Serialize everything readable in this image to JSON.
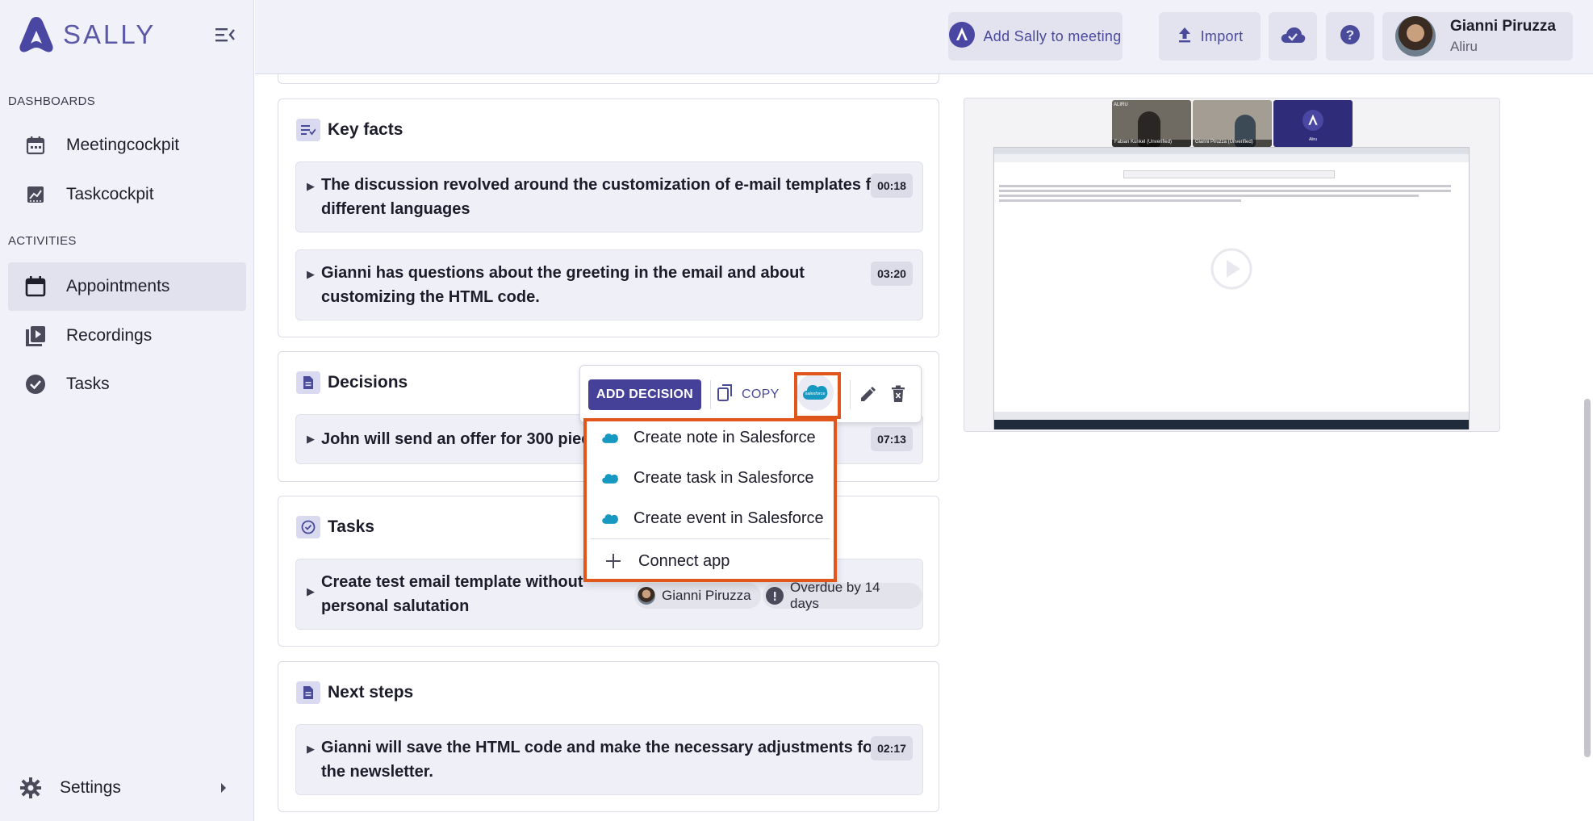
{
  "brand": {
    "name": "SALLY",
    "color": "#4a47a3"
  },
  "sidebar": {
    "sections": [
      {
        "label": "DASHBOARDS"
      },
      {
        "label": "ACTIVITIES"
      }
    ],
    "items": [
      {
        "label": "Meetingcockpit",
        "icon": "calendar-icon"
      },
      {
        "label": "Taskcockpit",
        "icon": "chart-icon"
      },
      {
        "label": "Appointments",
        "icon": "calendar-icon",
        "active": true
      },
      {
        "label": "Recordings",
        "icon": "video-library-icon"
      },
      {
        "label": "Tasks",
        "icon": "check-circle-icon"
      }
    ],
    "settings_label": "Settings"
  },
  "topbar": {
    "add_sally_label": "Add Sally to meeting",
    "import_label": "Import",
    "user": {
      "name": "Gianni Piruzza",
      "org": "Aliru"
    }
  },
  "cards": {
    "key_facts": {
      "title": "Key facts",
      "items": [
        {
          "text_line1": "The discussion revolved around the customization of e-mail templates for",
          "text_line2": "different languages",
          "time": "00:18"
        },
        {
          "text_line1": "Gianni has questions about the greeting in the email and about",
          "text_line2": "customizing the HTML code.",
          "time": "03:20"
        }
      ]
    },
    "decisions": {
      "title": "Decisions",
      "items": [
        {
          "text": "John will send an offer for 300 piece",
          "time": "07:13"
        }
      ]
    },
    "tasks": {
      "title": "Tasks",
      "items": [
        {
          "text_line1": "Create test email template without",
          "text_line2": "personal salutation",
          "assignee": "Gianni Piruzza",
          "status": "Overdue by 14 days"
        }
      ]
    },
    "next_steps": {
      "title": "Next steps",
      "items": [
        {
          "text_line1": "Gianni will save the HTML code and make the necessary adjustments for",
          "text_line2": "the newsletter.",
          "time": "02:17"
        }
      ]
    }
  },
  "toolbar": {
    "add_decision_label": "ADD DECISION",
    "copy_label": "COPY",
    "salesforce_icon_text": "salesforce"
  },
  "menu": {
    "items": [
      {
        "label": "Create note in Salesforce"
      },
      {
        "label": "Create task in Salesforce"
      },
      {
        "label": "Create event in Salesforce"
      },
      {
        "label": "Connect app"
      }
    ]
  },
  "video": {
    "participants": [
      {
        "name": "Fabian Kunkel (Unverified)"
      },
      {
        "name": "Gianni Piruzza (Unverified)"
      },
      {
        "name": "Aliru"
      }
    ],
    "thumb_label": "ALIRU"
  },
  "colors": {
    "accent": "#464198",
    "highlight": "#e0561b",
    "salesforce": "#1798c1"
  }
}
